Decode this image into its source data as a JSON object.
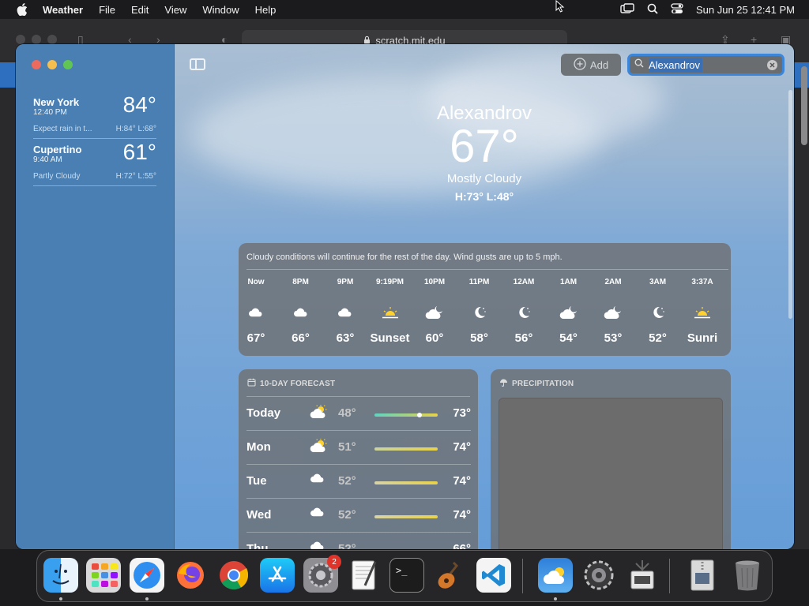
{
  "menubar": {
    "app_name": "Weather",
    "items": [
      "File",
      "Edit",
      "View",
      "Window",
      "Help"
    ],
    "clock": "Sun Jun 25  12:41 PM"
  },
  "safari": {
    "url": "scratch.mit.edu"
  },
  "sidebar": {
    "cities": [
      {
        "name": "New York",
        "time": "12:40 PM",
        "temp": "84°",
        "condition": "Expect rain in t...",
        "hilo": "H:84°  L:68°"
      },
      {
        "name": "Cupertino",
        "time": "9:40 AM",
        "temp": "61°",
        "condition": "Partly Cloudy",
        "hilo": "H:72°  L:55°"
      }
    ]
  },
  "toolbar": {
    "add_label": "Add",
    "search_value": "Alexandrov"
  },
  "current": {
    "location": "Alexandrov",
    "temp": "67°",
    "condition": "Mostly Cloudy",
    "hilo": "H:73°  L:48°"
  },
  "hourly": {
    "summary": "Cloudy conditions will continue for the rest of the day. Wind gusts are up to 5 mph.",
    "items": [
      {
        "label": "Now",
        "icon": "cloud-icon",
        "value": "67°"
      },
      {
        "label": "8PM",
        "icon": "cloud-icon",
        "value": "66°"
      },
      {
        "label": "9PM",
        "icon": "cloud-icon",
        "value": "63°"
      },
      {
        "label": "9:19PM",
        "icon": "sunset-icon",
        "value": "Sunset"
      },
      {
        "label": "10PM",
        "icon": "cloudy-night-icon",
        "value": "60°"
      },
      {
        "label": "11PM",
        "icon": "moon-icon",
        "value": "58°"
      },
      {
        "label": "12AM",
        "icon": "moon-icon",
        "value": "56°"
      },
      {
        "label": "1AM",
        "icon": "cloudy-night-icon",
        "value": "54°"
      },
      {
        "label": "2AM",
        "icon": "cloudy-night-icon",
        "value": "53°"
      },
      {
        "label": "3AM",
        "icon": "moon-icon",
        "value": "52°"
      },
      {
        "label": "3:37A",
        "icon": "sunrise-icon",
        "value": "Sunri"
      }
    ]
  },
  "ten_day": {
    "title": "10-DAY FORECAST",
    "days": [
      {
        "day": "Today",
        "icon": "partly-sunny-icon",
        "low": "48°",
        "high": "73°"
      },
      {
        "day": "Mon",
        "icon": "partly-sunny-icon",
        "low": "51°",
        "high": "74°"
      },
      {
        "day": "Tue",
        "icon": "cloud-icon",
        "low": "52°",
        "high": "74°"
      },
      {
        "day": "Wed",
        "icon": "cloud-icon",
        "low": "52°",
        "high": "74°"
      },
      {
        "day": "Thu",
        "icon": "cloud-icon",
        "low": "52°",
        "high": "66°"
      }
    ]
  },
  "precipitation": {
    "title": "PRECIPITATION"
  },
  "dock": {
    "apps": [
      "finder-icon",
      "launchpad-icon",
      "safari-icon",
      "firefox-icon",
      "chrome-icon",
      "app-store-icon",
      "system-preferences-icon",
      "textedit-icon",
      "terminal-icon",
      "garageband-icon",
      "vscode-icon",
      "weather-icon",
      "settings-icon",
      "preview-icon",
      "archive-utility-icon",
      "trash-icon"
    ],
    "settings_badge": "2"
  },
  "colors": {
    "accent": "#3b86d9",
    "sidebar": "#4a7fb3",
    "card": "#6e6e6e"
  }
}
